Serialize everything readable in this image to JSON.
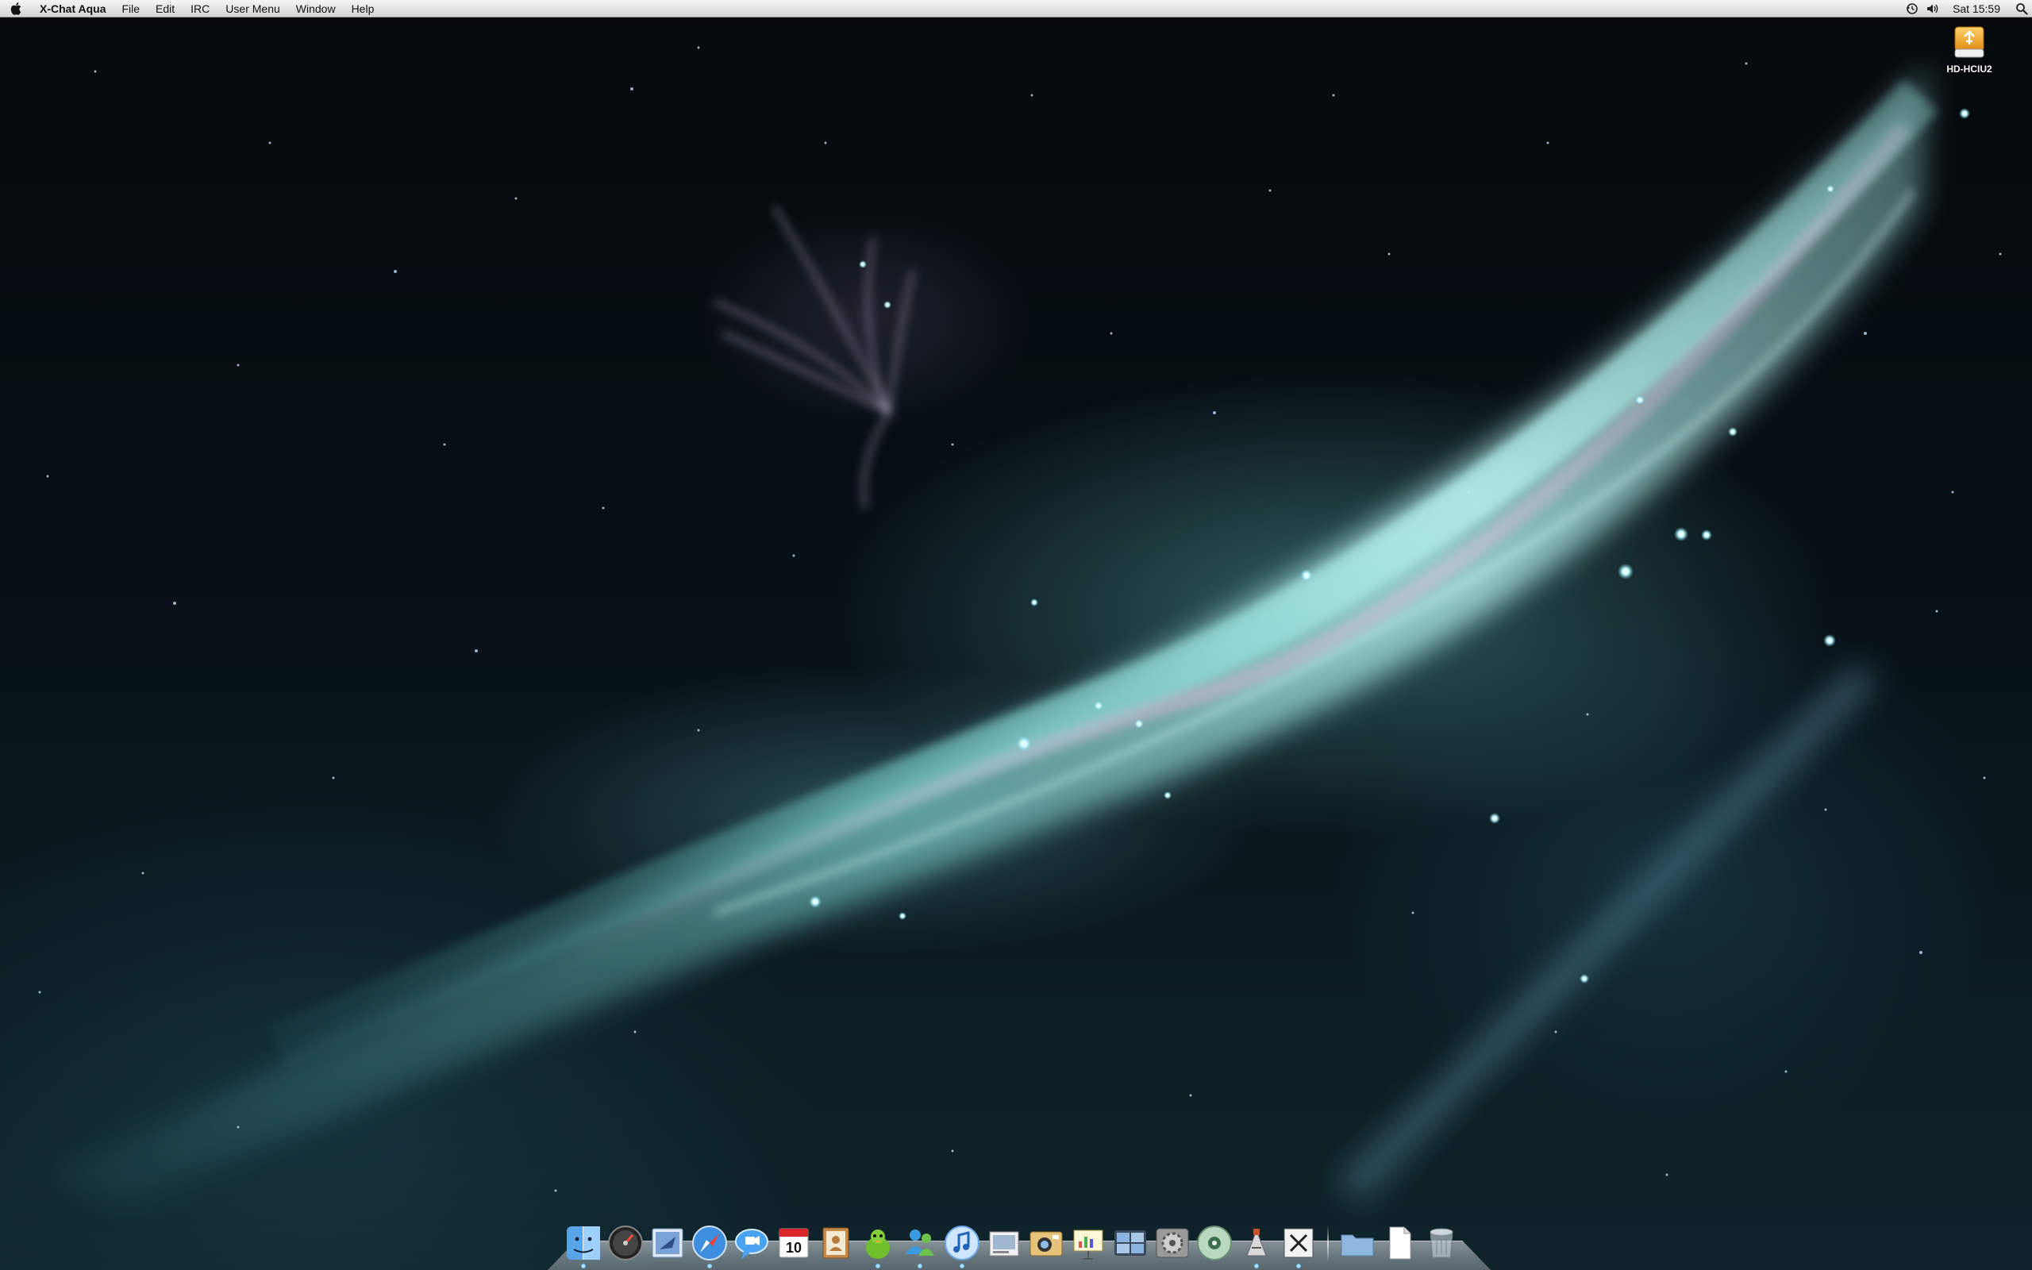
{
  "menubar": {
    "apple_icon": "apple-icon",
    "app_name": "X-Chat Aqua",
    "items": [
      "File",
      "Edit",
      "IRC",
      "User Menu",
      "Window",
      "Help"
    ],
    "status_icons": [
      "time-machine-icon",
      "volume-icon"
    ],
    "clock": "Sat 15:59",
    "spotlight_icon": "spotlight-search-icon"
  },
  "desktop": {
    "drive_label": "HD-HCIU2",
    "drive_icon": "external-drive-icon"
  },
  "dock": {
    "apps": [
      {
        "name": "finder",
        "icon": "finder-icon",
        "running": true
      },
      {
        "name": "dashboard",
        "icon": "dashboard-icon",
        "running": false
      },
      {
        "name": "mail",
        "icon": "mail-icon",
        "running": false
      },
      {
        "name": "safari",
        "icon": "safari-icon",
        "running": true
      },
      {
        "name": "ichat",
        "icon": "ichat-icon",
        "running": false
      },
      {
        "name": "ical",
        "icon": "ical-icon",
        "running": false,
        "label": "10"
      },
      {
        "name": "address-book",
        "icon": "address-book-icon",
        "running": false
      },
      {
        "name": "adium",
        "icon": "adium-icon",
        "running": true
      },
      {
        "name": "messenger",
        "icon": "messenger-icon",
        "running": true
      },
      {
        "name": "itunes",
        "icon": "itunes-icon",
        "running": true
      },
      {
        "name": "preview",
        "icon": "preview-icon",
        "running": false
      },
      {
        "name": "iphoto",
        "icon": "iphoto-icon",
        "running": false
      },
      {
        "name": "keynote",
        "icon": "keynote-icon",
        "running": false
      },
      {
        "name": "spaces",
        "icon": "spaces-icon",
        "running": false
      },
      {
        "name": "system-preferences",
        "icon": "system-preferences-icon",
        "running": false
      },
      {
        "name": "dvd-player",
        "icon": "dvd-player-icon",
        "running": false
      },
      {
        "name": "script-editor",
        "icon": "script-editor-icon",
        "running": true
      },
      {
        "name": "x11",
        "icon": "x11-icon",
        "running": true
      }
    ],
    "stacks": [
      {
        "name": "documents-stack",
        "icon": "folder-icon"
      },
      {
        "name": "downloads-stack",
        "icon": "document-icon"
      },
      {
        "name": "trash",
        "icon": "trash-icon"
      }
    ]
  }
}
